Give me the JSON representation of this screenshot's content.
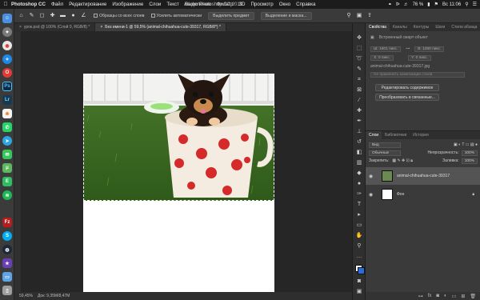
{
  "menubar": {
    "apple": "",
    "app": "Photoshop CC",
    "items": [
      "Файл",
      "Редактирование",
      "Изображение",
      "Слои",
      "Текст",
      "Выделение",
      "Фильтр",
      "3D",
      "Просмотр",
      "Окно",
      "Справка"
    ],
    "battery": "76 %",
    "clock": "Вс 11:06"
  },
  "window_title": "Adobe Photoshop CC 2019",
  "options": {
    "sample_all_layers": "Образцы со всех слоев",
    "auto_enhance": "Усилить автоматически",
    "select_subject": "Выделить предмет",
    "select_and_mask": "Выделение и маска..."
  },
  "tabs": [
    {
      "label": "урок.psd @ 100% (Слой 0, RGB/8) *",
      "active": false
    },
    {
      "label": "Без имени-1 @ 59,5% (animal-chihuahua-cute-39317, RGB/8*) *",
      "active": true
    }
  ],
  "status": {
    "zoom": "59,45%",
    "doc": "Док: 9,35M/8,47M"
  },
  "properties": {
    "tabs": [
      "Свойства",
      "Каналы",
      "Контуры",
      "Шаги",
      "Стили абзаца"
    ],
    "object_type": "Встроенный смарт-объект",
    "w": "Ш: 1601 пикс.",
    "h": "В: 1280 пикс.",
    "x": "X: 0 пикс.",
    "y": "Y: 0 пикс.",
    "filename": "animal-chihuahua-cute-39317.jpg",
    "comp_hint": "Не применять композиции слоев",
    "edit_contents": "Редактировать содержимое",
    "convert_linked": "Преобразовать в связанные..."
  },
  "layers": {
    "tabs": [
      "Слои",
      "Библиотеки",
      "История"
    ],
    "kind": "Вид",
    "blend": "Обычные",
    "opacity_label": "Непрозрачность:",
    "opacity": "100%",
    "lock_label": "Закрепить:",
    "fill_label": "Заливка:",
    "fill": "100%",
    "items": [
      {
        "name": "animal-chihuahua-cute-39317",
        "selected": true
      },
      {
        "name": "Фон",
        "selected": false
      }
    ]
  },
  "dock_icons": [
    "finder-icon",
    "launchpad-icon",
    "chrome-icon",
    "safari-icon",
    "opera-icon",
    "photoshop-icon",
    "lightroom-icon",
    "photos-icon",
    "whatsapp-icon",
    "telegram-icon",
    "messages-icon",
    "utorrent-icon",
    "evernote-icon",
    "spotify-icon",
    "filezilla-icon",
    "skype-icon",
    "steam-icon",
    "text-edit-icon",
    "imovie-icon",
    "folder-icon",
    "trash-icon"
  ],
  "colors": {
    "dock_bg": "#3b3b3b",
    "panel_bg": "#3a3a3a",
    "canvas_bg": "#262626",
    "accent": "#2b6bd9"
  }
}
